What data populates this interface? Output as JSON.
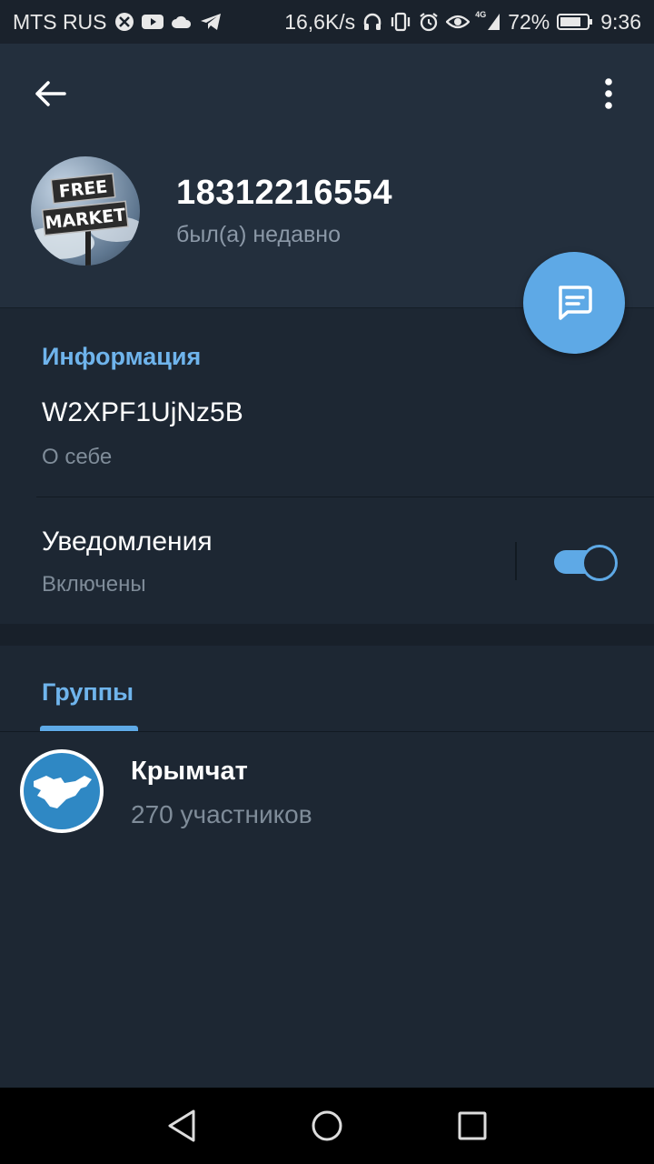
{
  "status_bar": {
    "carrier": "MTS RUS",
    "speed": "16,6K/s",
    "network": "4G",
    "battery": "72%",
    "time": "9:36"
  },
  "profile": {
    "name": "18312216554",
    "status": "был(а) недавно",
    "avatar_lines": [
      "FREE",
      "MARKET"
    ]
  },
  "info": {
    "heading": "Информация",
    "bio_value": "W2XPF1UjNz5B",
    "bio_caption": "О себе",
    "notifications_title": "Уведомления",
    "notifications_state": "Включены",
    "notifications_on": true
  },
  "groups": {
    "tab_label": "Группы",
    "items": [
      {
        "name": "Крымчат",
        "members": "270 участников"
      }
    ]
  },
  "colors": {
    "accent": "#5ea9e6",
    "background": "#1d2733",
    "header": "#232f3d"
  },
  "icons": {
    "back": "arrow-left-icon",
    "menu": "more-vertical-icon",
    "fab": "message-icon"
  }
}
